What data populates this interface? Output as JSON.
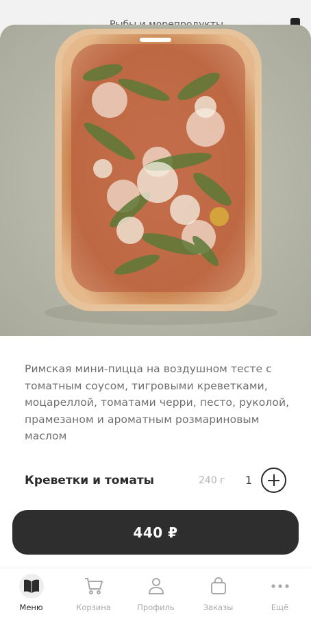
{
  "background_header": {
    "title": "Рыбы и морепродукты"
  },
  "product": {
    "image_alt": "Римская мини-пицца с креветками, руколой и пармезаном",
    "description": "Римская мини-пицца на воздушном тесте с томатным соусом, тигровыми креветками, моцареллой, томатами черри, песто, руколой, прамезаном и ароматным розмариновым маслом",
    "option": {
      "name": "Креветки и томаты",
      "weight": "240 г",
      "quantity": "1"
    },
    "price_label": "440 ₽"
  },
  "tabbar": {
    "items": [
      {
        "label": "Меню",
        "icon": "book-icon",
        "active": true
      },
      {
        "label": "Корзина",
        "icon": "cart-icon",
        "active": false
      },
      {
        "label": "Профиль",
        "icon": "user-icon",
        "active": false
      },
      {
        "label": "Заказы",
        "icon": "bag-icon",
        "active": false
      },
      {
        "label": "Ещё",
        "icon": "more-dots-icon",
        "active": false
      }
    ]
  },
  "colors": {
    "accent": "#2e2e2e",
    "muted": "#a8a8a8",
    "text": "#6f6f6f"
  }
}
